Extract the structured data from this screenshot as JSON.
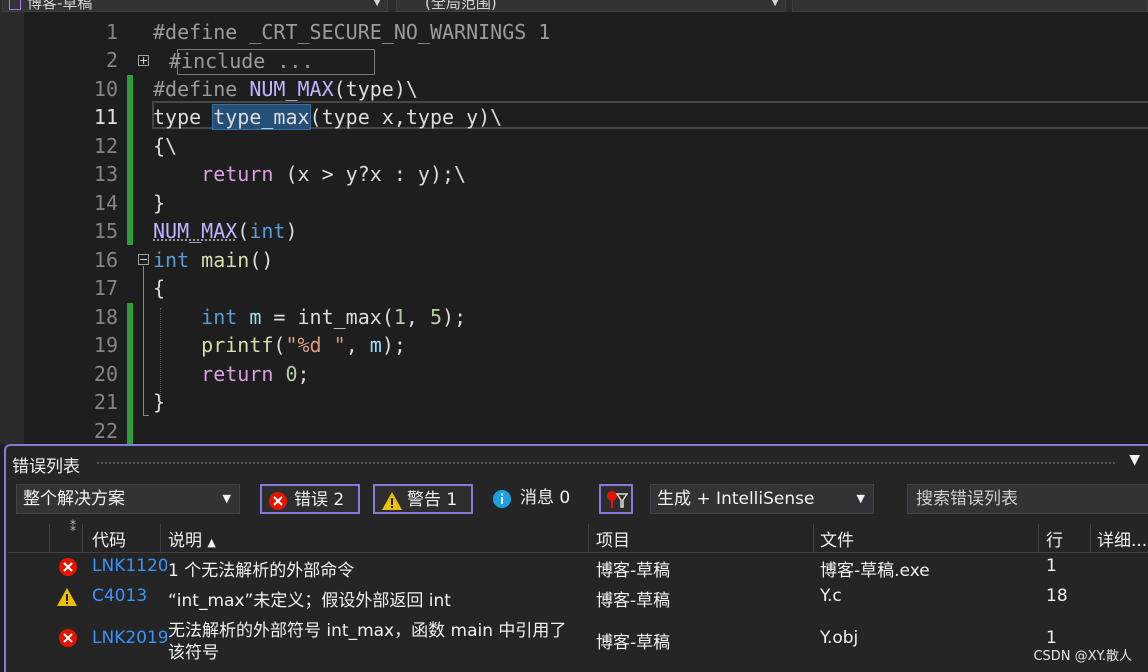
{
  "nav": {
    "file_dropdown": "博客-草稿",
    "scope_dropdown": "(全局范围)"
  },
  "editor": {
    "line_numbers": [
      "1",
      "2",
      "10",
      "11",
      "12",
      "13",
      "14",
      "15",
      "16",
      "17",
      "18",
      "19",
      "20",
      "21",
      "22"
    ],
    "collapsed_text": "#include ...",
    "define1": {
      "kw": "#define",
      "name": "_CRT_SECURE_NO_WARNINGS",
      "val": "1"
    },
    "define2": {
      "kw": "#define",
      "name": "NUM_MAX",
      "rest": "(type)\\"
    },
    "l11": {
      "a": "type",
      "sel": "type_max",
      "b": "(type x,type y)\\"
    },
    "l12": "{\\",
    "l13": {
      "kw": "return",
      "rest": " (x > y?x : y);\\"
    },
    "l14": "}",
    "l15": {
      "mac": "NUM_MAX",
      "kw": "int"
    },
    "l16": {
      "kw": "int",
      "fn": "main",
      "rest": "()"
    },
    "l17": "{",
    "l18": {
      "kw": "int",
      "var": "m",
      "op": " = ",
      "fn": "int_max",
      "a": "(",
      "n1": "1",
      "c": ", ",
      "n2": "5",
      "d": ");"
    },
    "l19": {
      "fn": "printf",
      "a": "(",
      "str": "\"%d \"",
      "b": ", ",
      "var": "m",
      "c": ");"
    },
    "l20": {
      "kw": "return",
      "num": "0",
      "end": ";"
    },
    "l21": "}"
  },
  "error_list": {
    "title": "错误列表",
    "scope_dropdown": "整个解决方案",
    "errors_button": "错误 2",
    "warnings_button": "警告 1",
    "messages_button": "消息 0",
    "build_dropdown": "生成 + IntelliSense",
    "search_placeholder": "搜索错误列表",
    "columns": {
      "code": "代码",
      "desc": "说明",
      "project": "项目",
      "file": "文件",
      "line": "行",
      "detail": "详细..."
    },
    "rows": [
      {
        "type": "error",
        "code": "LNK1120",
        "desc": "1 个无法解析的外部命令",
        "project": "博客-草稿",
        "file": "博客-草稿.exe",
        "line": "1"
      },
      {
        "type": "warning",
        "code": "C4013",
        "desc": "“int_max”未定义；假设外部返回 int",
        "project": "博客-草稿",
        "file": "Y.c",
        "line": "18"
      },
      {
        "type": "error",
        "code": "LNK2019",
        "desc1": "无法解析的外部符号 int_max，函数 main 中引用了",
        "desc2": "该符号",
        "project": "博客-草稿",
        "file": "Y.obj",
        "line": "1"
      }
    ]
  },
  "watermark": "CSDN @XY.散人"
}
